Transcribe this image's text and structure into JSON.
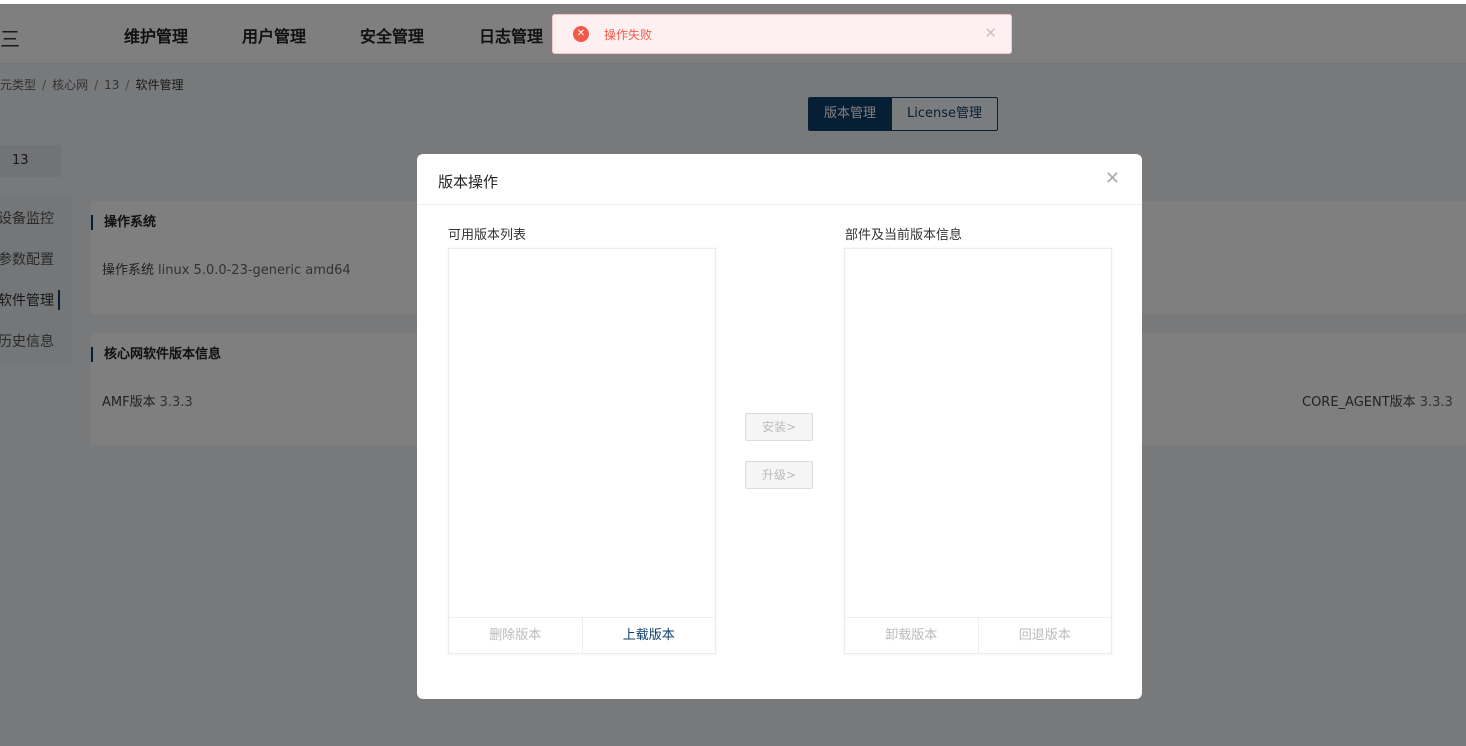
{
  "topbar": {
    "menu_icon": "三",
    "nav": [
      "维护管理",
      "用户管理",
      "安全管理",
      "日志管理"
    ]
  },
  "breadcrumb": {
    "items": [
      "元类型",
      "核心网",
      "13"
    ],
    "current": "软件管理",
    "separator": "/"
  },
  "tabs": {
    "version": "版本管理",
    "license": "License管理"
  },
  "device": {
    "name": "13"
  },
  "side_menu": {
    "items": [
      "设备监控",
      "参数配置",
      "软件管理",
      "历史信息"
    ],
    "active_index": 2
  },
  "cards": {
    "os": {
      "title": "操作系统",
      "label": "操作系统",
      "value": "linux 5.0.0-23-generic amd64"
    },
    "core": {
      "title": "核心网软件版本信息",
      "amf_label": "AMF版本",
      "amf_value": "3.3.3",
      "agent_label": "CORE_AGENT版本",
      "agent_value": "3.3.3"
    }
  },
  "modal": {
    "title": "版本操作",
    "close_icon": "close-icon",
    "left_label": "可用版本列表",
    "right_label": "部件及当前版本信息",
    "install": "安装>",
    "upgrade": "升级>",
    "delete": "删除版本",
    "upload": "上载版本",
    "uninstall": "卸载版本",
    "rollback": "回退版本"
  },
  "toast": {
    "icon": "error-icon",
    "text": "操作失败",
    "color": "#f05a4b"
  },
  "colors": {
    "primary": "#0e3e6a",
    "error": "#f05a4b"
  }
}
